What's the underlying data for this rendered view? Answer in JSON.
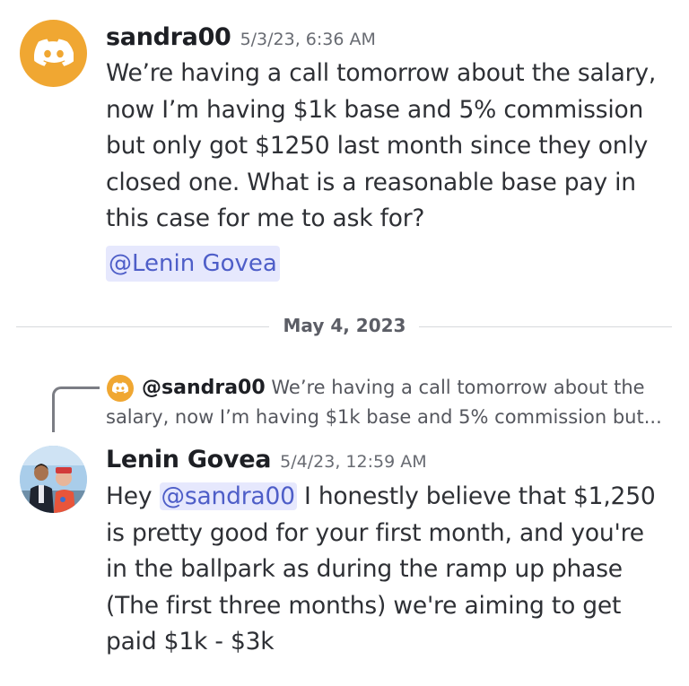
{
  "messages": [
    {
      "author": "sandra00",
      "timestamp": "5/3/23, 6:36 AM",
      "avatar_icon": "discord-logo-icon",
      "avatar_color": "#f0a732",
      "lines": [
        "We’re having a call tomorrow about the salary,",
        "now I’m having $1k base and 5% commission",
        "but only got $1250 last month since they only",
        "closed one. What is a reasonable base pay in",
        "this case for me to ask for?"
      ],
      "mention": "@Lenin Govea"
    },
    {
      "author": "Lenin Govea",
      "timestamp": "5/4/23, 12:59 AM",
      "avatar_icon": "user-photo-avatar",
      "reply": {
        "user": "@sandra00",
        "preview_line1": "We’re having a call tomorrow about the",
        "preview_line2": "salary, now I’m having $1k base and 5% commission but..."
      },
      "line1_prefix": "Hey ",
      "mention": "@sandra00",
      "line1_suffix": " I honestly believe that $1,250",
      "lines": [
        "is pretty good for your first month, and you're",
        "in the ballpark as during the ramp up phase",
        "(The first three months) we're aiming to get",
        "paid $1k - $3k"
      ]
    }
  ],
  "date_divider": "May 4, 2023",
  "colors": {
    "mention_bg": "#e6e8fd",
    "mention_text": "#4e5ec8",
    "discord_avatar": "#f0a732"
  }
}
